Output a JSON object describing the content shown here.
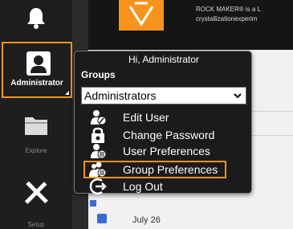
{
  "sidebar": {
    "items": [
      {
        "label": "Administrator",
        "icon": "user-icon"
      },
      {
        "label": "Explore",
        "icon": "folder-icon"
      },
      {
        "label": "Setup",
        "icon": "tools-icon"
      }
    ],
    "notification_icon": "bell-icon"
  },
  "banner": {
    "text_line1": "ROCK MAKER® is a L",
    "text_line2": "crystallizationexperim"
  },
  "popup": {
    "greeting": "Hi, Administrator",
    "groups_label": "Groups",
    "group_select_value": "Administrators",
    "items": [
      {
        "label": "Edit User",
        "icon": "edit-user-icon"
      },
      {
        "label": "Change Password",
        "icon": "lock-icon"
      },
      {
        "label": "User Preferences",
        "icon": "user-preferences-icon"
      },
      {
        "label": "Group Preferences",
        "icon": "group-preferences-icon"
      },
      {
        "label": "Log Out",
        "icon": "logout-icon"
      }
    ]
  },
  "content": {
    "date_label": "July 26"
  },
  "colors": {
    "accent": "#f7941d",
    "sidebar_bg": "#1e1e1e",
    "popup_bg": "#1b1b1b"
  }
}
